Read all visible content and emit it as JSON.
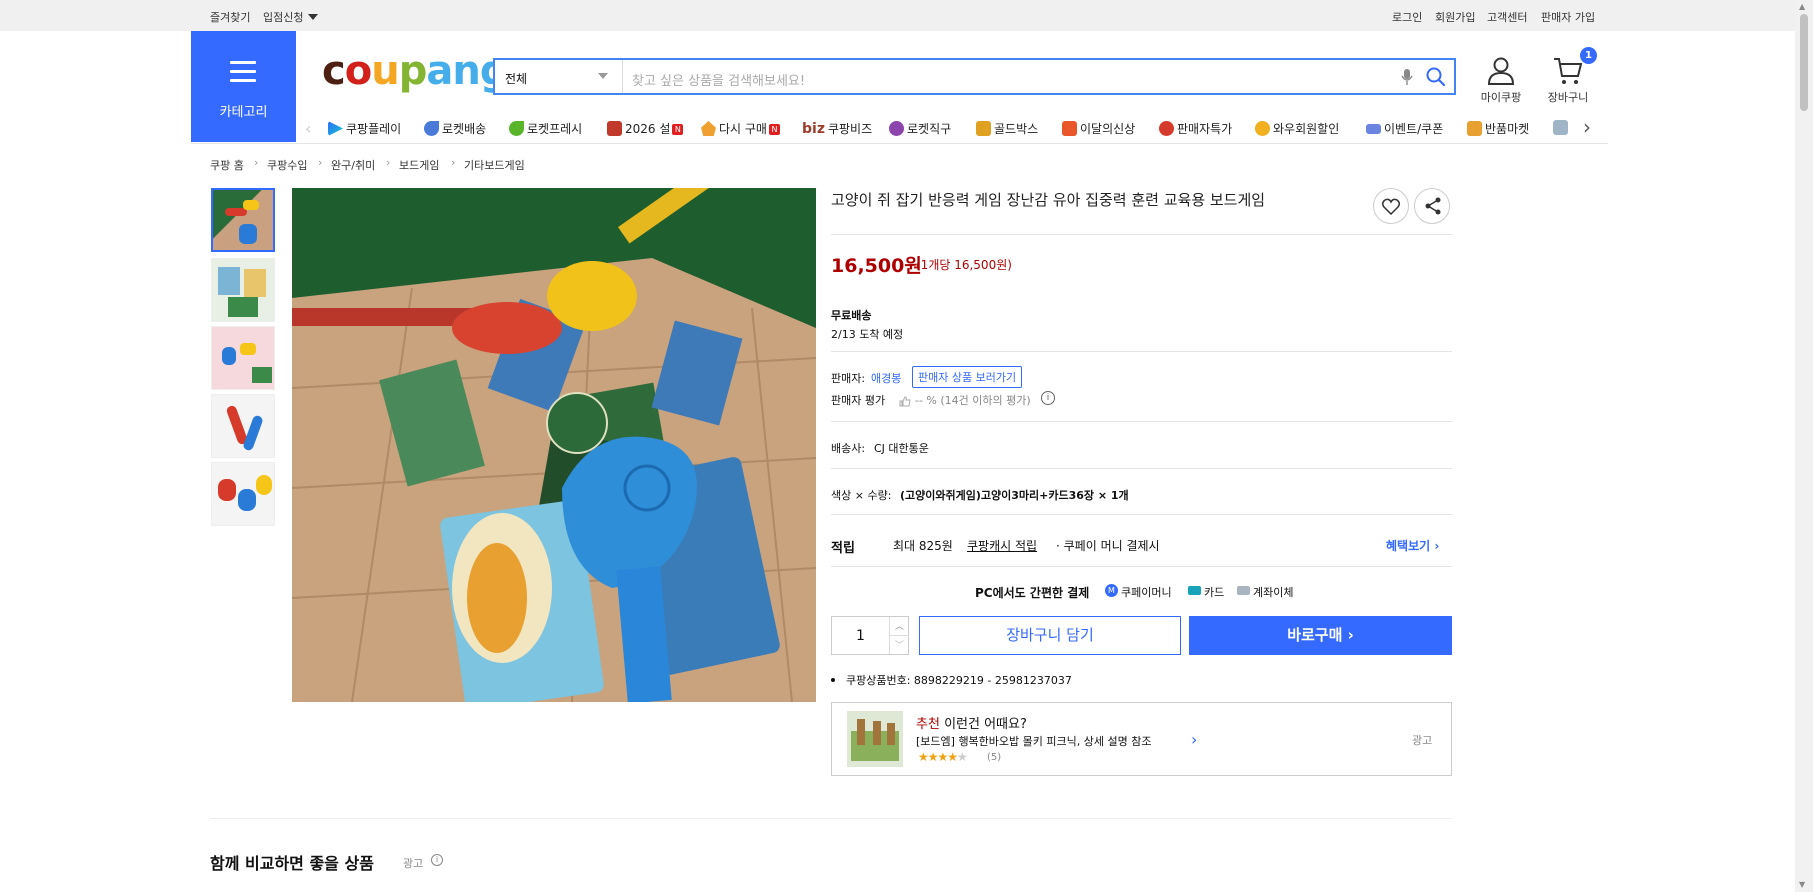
{
  "topbar": {
    "left": [
      "즐겨찾기",
      "입점신청"
    ],
    "right": [
      "로그인",
      "회원가입",
      "고객센터",
      "판매자 가입"
    ]
  },
  "header": {
    "category_label": "카테고리",
    "logo": {
      "c1": "c",
      "c2": "o",
      "c3": "u",
      "c4": "p",
      "c5": "a",
      "c6": "n",
      "c7": "g"
    },
    "search": {
      "category": "전체",
      "placeholder": "찾고 싶은 상품을 검색해보세요!"
    },
    "mycoupang": "마이쿠팡",
    "cart": "장바구니",
    "cart_count": "1"
  },
  "nav": [
    "쿠팡플레이",
    "로켓배송",
    "로켓프레시",
    "2026 설",
    "다시 구매",
    "쿠팡비즈",
    "로켓직구",
    "골드박스",
    "이달의신상",
    "판매자특가",
    "와우회원할인",
    "이벤트/쿠폰",
    "반품마켓"
  ],
  "nav_biz": "biz",
  "breadcrumb": [
    "쿠팡 홈",
    "쿠팡수입",
    "완구/취미",
    "보드게임",
    "기타보드게임"
  ],
  "product": {
    "title": "고양이 쥐 잡기 반응력 게임 장난감 유아 집중력 훈련 교육용 보드게임",
    "price": "16,500원",
    "unit_price": "(1개당 16,500원)",
    "shipping_label": "무료배송",
    "arrival": "2/13 도착 예정",
    "seller_label": "판매자:",
    "seller_name": "애경봉",
    "seller_link": "판매자 상품 보러가기",
    "seller_rating_label": "판매자 평가",
    "seller_rating_value": "-- % (14건 이하의 평가)",
    "carrier_label": "배송사:",
    "carrier": "CJ 대한통운",
    "option_label": "색상 × 수량:",
    "option_value": "(고양이와쥐게임)고양이3마리+카드36장 × 1개",
    "reward_label": "적립",
    "reward_text1": "최대 825원",
    "reward_link": "쿠팡캐시 적립",
    "reward_text2": "· 쿠페이 머니 결제시",
    "benefit_link": "혜택보기",
    "pay_title": "PC에서도 간편한 결제",
    "pay_methods": [
      "쿠페이머니",
      "카드",
      "계좌이체"
    ],
    "quantity": "1",
    "cart_button": "장바구니 담기",
    "buy_button": "바로구매",
    "product_no": "쿠팡상품번호: 8898229219 - 25981237037"
  },
  "recommend": {
    "prefix": "추천",
    "title": "이런건 어때요?",
    "item": "[보드엠] 행복한바오밥 몰키 피크닉, 상세 설명 참조",
    "reviews": "(5)",
    "ad": "광고",
    "rating": 4
  },
  "compare": {
    "title": "함께 비교하면 좋을 상품",
    "ad": "광고"
  },
  "colors": {
    "brand_blue": "#346aff",
    "price_red": "#ae0000"
  }
}
